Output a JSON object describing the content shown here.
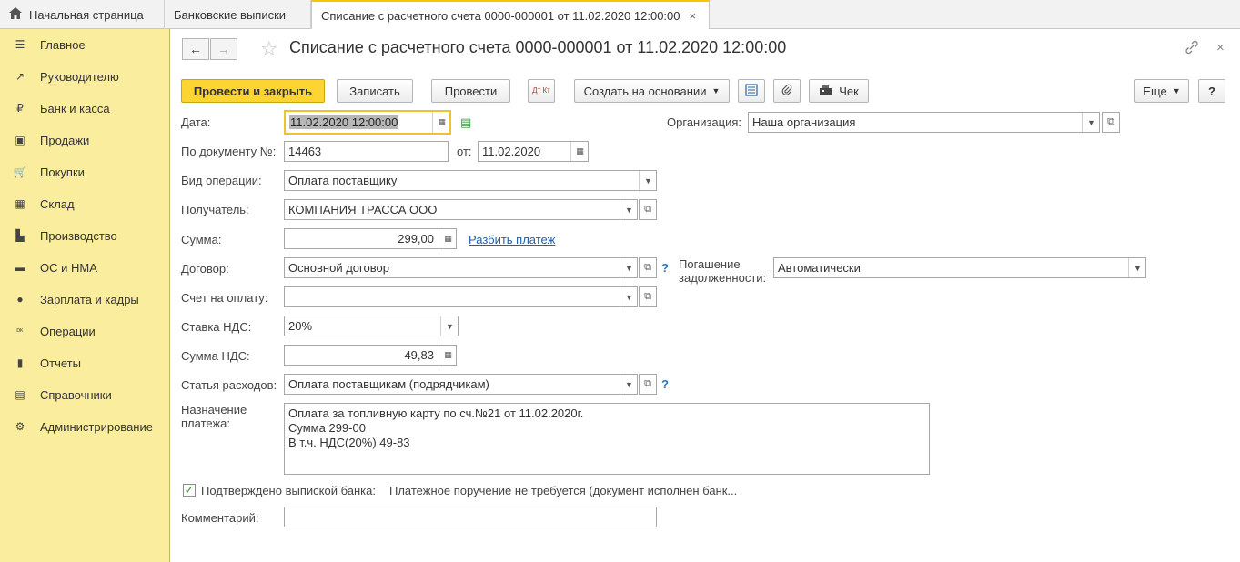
{
  "tabs": {
    "home": "Начальная страница",
    "bank": "Банковские выписки",
    "current": "Списание с расчетного счета 0000-000001 от 11.02.2020 12:00:00",
    "close_glyph": "×"
  },
  "sidebar": {
    "items": [
      {
        "label": "Главное",
        "icon": "menu-icon",
        "glyph": "☰"
      },
      {
        "label": "Руководителю",
        "icon": "trend-icon",
        "glyph": "↗"
      },
      {
        "label": "Банк и касса",
        "icon": "ruble-icon",
        "glyph": "₽"
      },
      {
        "label": "Продажи",
        "icon": "bag-icon",
        "glyph": "▣"
      },
      {
        "label": "Покупки",
        "icon": "cart-icon",
        "glyph": "🛒"
      },
      {
        "label": "Склад",
        "icon": "warehouse-icon",
        "glyph": "▦"
      },
      {
        "label": "Производство",
        "icon": "factory-icon",
        "glyph": "▙"
      },
      {
        "label": "ОС и НМА",
        "icon": "truck-icon",
        "glyph": "▬"
      },
      {
        "label": "Зарплата и кадры",
        "icon": "person-icon",
        "glyph": "●"
      },
      {
        "label": "Операции",
        "icon": "dtkt-icon",
        "glyph": "ᴰᴷ"
      },
      {
        "label": "Отчеты",
        "icon": "bar-chart-icon",
        "glyph": "▮"
      },
      {
        "label": "Справочники",
        "icon": "book-icon",
        "glyph": "▤"
      },
      {
        "label": "Администрирование",
        "icon": "gear-icon",
        "glyph": "⚙"
      }
    ]
  },
  "header": {
    "title": "Списание с расчетного счета 0000-000001 от 11.02.2020 12:00:00",
    "back_glyph": "🡐",
    "forward_glyph": "🡒",
    "star_glyph": "☆",
    "link_glyph": "🔗",
    "close_glyph": "×"
  },
  "toolbar": {
    "post_close": "Провести и закрыть",
    "save": "Записать",
    "post": "Провести",
    "dtkt": "Дт Кт",
    "create_based": "Создать на основании",
    "receipt": "Чек",
    "more": "Еще",
    "help": "?"
  },
  "form": {
    "date_label": "Дата:",
    "date_value": "11.02.2020 12:00:00",
    "org_label": "Организация:",
    "org_value": "Наша организация",
    "docnum_label": "По документу №:",
    "docnum_value": "14463",
    "from_label": "от:",
    "from_value": "11.02.2020",
    "optype_label": "Вид операции:",
    "optype_value": "Оплата поставщику",
    "recipient_label": "Получатель:",
    "recipient_value": "КОМПАНИЯ ТРАССА ООО",
    "sum_label": "Сумма:",
    "sum_value": "299,00",
    "split_link": "Разбить платеж",
    "contract_label": "Договор:",
    "contract_value": "Основной договор",
    "repay_label_1": "Погашение",
    "repay_label_2": "задолженности:",
    "repay_value": "Автоматически",
    "invoice_label": "Счет на оплату:",
    "invoice_value": "",
    "vat_rate_label": "Ставка НДС:",
    "vat_rate_value": "20%",
    "vat_sum_label": "Сумма НДС:",
    "vat_sum_value": "49,83",
    "expense_label": "Статья расходов:",
    "expense_value": "Оплата поставщикам (подрядчикам)",
    "purpose_label_1": "Назначение",
    "purpose_label_2": "платежа:",
    "purpose_line1": "Оплата за топливную карту по сч.№21 от 11.02.2020г.",
    "purpose_line2": "Сумма 299-00",
    "purpose_line3": "В т.ч. НДС(20%) 49-83",
    "confirmed_label": "Подтверждено выпиской банка:",
    "confirmed_checked": true,
    "confirmed_note": "Платежное поручение не требуется (документ исполнен банк...",
    "comment_label": "Комментарий:",
    "comment_value": "",
    "help_glyph": "?"
  }
}
